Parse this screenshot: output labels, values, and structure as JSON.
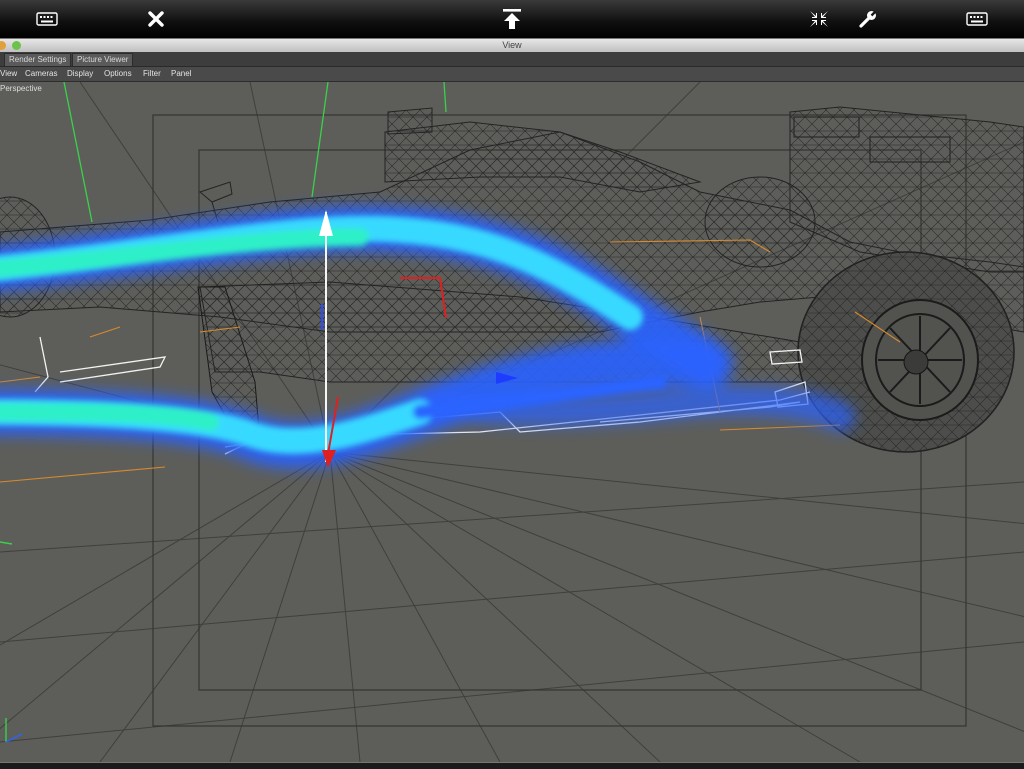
{
  "window": {
    "title": "View"
  },
  "tabs": [
    "Render Settings",
    "Picture Viewer"
  ],
  "menu": [
    "View",
    "Cameras",
    "Display",
    "Options",
    "Filter",
    "Panel"
  ],
  "viewport": {
    "label": "Perspective"
  },
  "toolbar": {
    "left_keyboard_icon": "keyboard-icon",
    "close_icon": "close-icon",
    "upload_icon": "upload-arrow-icon",
    "shrink_icon": "collapse-icon",
    "settings_icon": "wrench-icon",
    "right_keyboard_icon": "keyboard-icon"
  },
  "colors": {
    "viewport_bg": "#5d5e5a",
    "flow_cyan": "#2ff0c8",
    "flow_blue": "#2a63ff",
    "axis_green": "#3bd04a",
    "axis_red": "#e02020",
    "guide_orange": "#d88a2c"
  }
}
